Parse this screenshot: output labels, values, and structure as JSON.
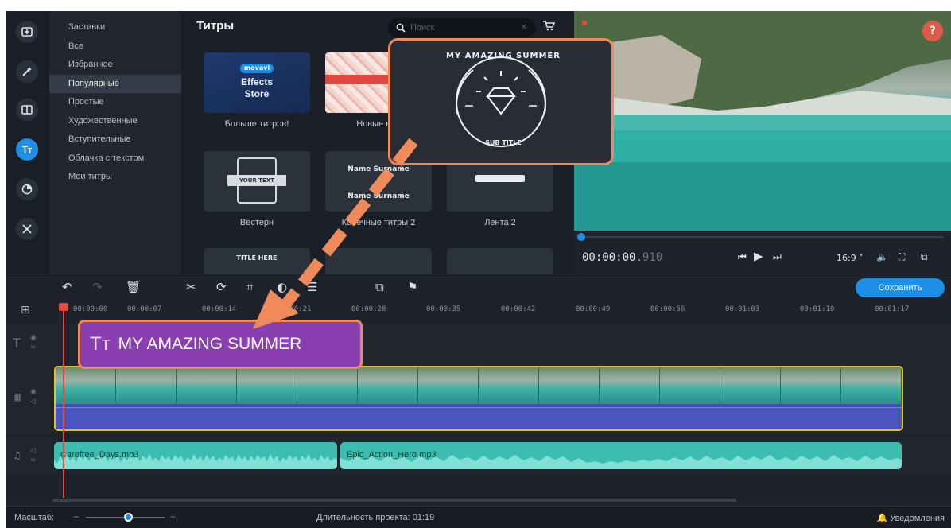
{
  "sidebar": {
    "categories": [
      "Заставки",
      "Все",
      "Избранное",
      "Популярные",
      "Простые",
      "Художественные",
      "Вступительные",
      "Облачка с текстом",
      "Мои титры"
    ],
    "active_index": 3
  },
  "titles_panel": {
    "heading": "Титры",
    "search_placeholder": "Поиск",
    "store_tile": {
      "badge": "movavi",
      "line1": "Effects",
      "line2": "Store"
    },
    "tiles": [
      {
        "label": "Больше титров!"
      },
      {
        "label": "Новые наб"
      },
      {
        "label": "Вестерн",
        "art_text": "YOUR TEXT"
      },
      {
        "label": "Конечные титры 2",
        "art_text": "Name Surname"
      },
      {
        "label": "Лента 2"
      },
      {
        "label": "",
        "art_text": "TITLE HERE"
      }
    ]
  },
  "popup": {
    "top_text": "MY AMAZING SUMMER",
    "bottom_text": "SUB TITLE"
  },
  "preview": {
    "help_label": "?",
    "timecode_main": "00:00:00.",
    "timecode_ms": "910",
    "aspect": "16:9 ˅"
  },
  "toolbar": {
    "save_label": "Сохранить"
  },
  "timeline": {
    "ruler_ticks": [
      "00:00:00",
      "00:00:07",
      "00:00:14",
      "00:00:21",
      "00:00:28",
      "00:00:35",
      "00:00:42",
      "00:00:49",
      "00:00:56",
      "00:01:03",
      "00:01:10",
      "00:01:17"
    ],
    "title_clip": {
      "icon": "Tт",
      "text": "MY AMAZING SUMMER"
    },
    "audio_clips": [
      {
        "label": "Carefree_Days.mp3"
      },
      {
        "label": "Epic_Action_Hero.mp3"
      }
    ]
  },
  "status": {
    "zoom_label": "Масштаб:",
    "duration_label": "Длительность проекта: 01:19",
    "notifications_label": "Уведомления"
  },
  "colors": {
    "accent": "#1e8fe6",
    "highlight": "#ef8a5a",
    "title_clip": "#8a3fb0",
    "audio_clip": "#3dbcb0",
    "video_border": "#e0c12c"
  }
}
